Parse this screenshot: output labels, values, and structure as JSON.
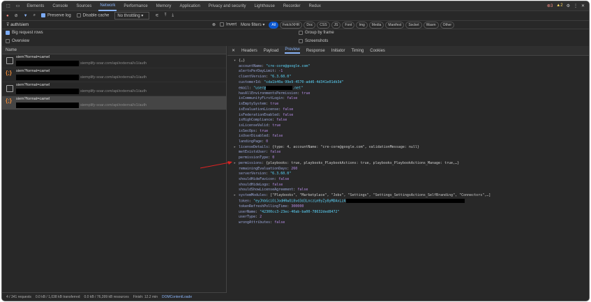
{
  "tabs": [
    "Elements",
    "Console",
    "Sources",
    "Network",
    "Performance",
    "Memory",
    "Application",
    "Privacy and security",
    "Lighthouse",
    "Recorder",
    "Redux"
  ],
  "active_tab": "Network",
  "badges": {
    "errors": "3",
    "warnings": "2"
  },
  "toolbar": {
    "preserve_log": "Preserve log",
    "disable_cache": "Disable cache",
    "throttling": "No throttling"
  },
  "filter": {
    "value": "auth/siem",
    "invert": "Invert",
    "more_filters": "More filters",
    "types": [
      "All",
      "Fetch/XHR",
      "Doc",
      "CSS",
      "JS",
      "Font",
      "Img",
      "Media",
      "Manifest",
      "Socket",
      "Wasm",
      "Other"
    ]
  },
  "options": {
    "big_rows": "Big request rows",
    "overview": "Overview",
    "group_by_frame": "Group by frame",
    "screenshots": "Screenshots"
  },
  "list": {
    "header": "Name",
    "rows": [
      {
        "name": "siem?format=camel",
        "url": "siemplify-soar.com/api/external/v1/auth",
        "icon": "document"
      },
      {
        "name": "siem?format=camel",
        "url": "siemplify-soar.com/api/external/v1/auth",
        "icon": "json"
      },
      {
        "name": "siem?format=camel",
        "url": "siemplify-soar.com/api/external/v1/auth",
        "icon": "document"
      },
      {
        "name": "siem?format=camel",
        "url": "siemplify-soar.com/api/external/v1/auth",
        "icon": "json"
      }
    ]
  },
  "detail_tabs": [
    "Headers",
    "Payload",
    "Preview",
    "Response",
    "Initiator",
    "Timing",
    "Cookies"
  ],
  "active_detail_tab": "Preview",
  "preview": {
    "root": "{…}",
    "lines": [
      {
        "k": "accountName",
        "v": "\"cre-core@google.com\"",
        "t": "s"
      },
      {
        "k": "alertsPerDayLimit",
        "v": "-1",
        "t": "b"
      },
      {
        "k": "clientVersion",
        "v": "\"6.3.60.0\"",
        "t": "s"
      },
      {
        "k": "customerId",
        "v": "\"cda1b40a-99e9-4570-add6-4d341e01db3d\"",
        "t": "s"
      },
      {
        "k": "email",
        "v": "\"user@",
        "v2": ".net\"",
        "t": "s",
        "redact": true
      },
      {
        "k": "hasAllEnvironmentsPermission",
        "v": "true",
        "t": "b"
      },
      {
        "k": "isCommunityFirstLogin",
        "v": "false",
        "t": "b"
      },
      {
        "k": "isEmptySystem",
        "v": "true",
        "t": "b"
      },
      {
        "k": "isEvaluationLicense",
        "v": "false",
        "t": "b"
      },
      {
        "k": "isFederationEnabled",
        "v": "false",
        "t": "b"
      },
      {
        "k": "isHighCompliance",
        "v": "false",
        "t": "b"
      },
      {
        "k": "isLicenseValid",
        "v": "true",
        "t": "b"
      },
      {
        "k": "isSecOps",
        "v": "true",
        "t": "b"
      },
      {
        "k": "isUserDisabled",
        "v": "false",
        "t": "b"
      },
      {
        "k": "landingPage",
        "v": "0",
        "t": "b"
      },
      {
        "k": "licenseDetails",
        "v": "{type: 4, accountName: \"cre-core@google.com\", validationMessage: null}",
        "t": "o",
        "exp": true
      },
      {
        "k": "metExistsUser",
        "v": "false",
        "t": "b"
      },
      {
        "k": "permissionType",
        "v": "0",
        "t": "b"
      },
      {
        "k": "permissions",
        "v": "{playbooks: true, playbooks_PlaybookActions: true, playbooks_PlaybookActions_Manage: true,…}",
        "t": "o",
        "exp": true
      },
      {
        "k": "remainingEvaluationDays",
        "v": "260",
        "t": "b"
      },
      {
        "k": "serverVersion",
        "v": "\"6.3.60.0\"",
        "t": "s"
      },
      {
        "k": "shouldHideFavicon",
        "v": "false",
        "t": "b"
      },
      {
        "k": "shouldHideLogo",
        "v": "false",
        "t": "b"
      },
      {
        "k": "shouldShowLicenseAgreement",
        "v": "false",
        "t": "b"
      },
      {
        "k": "systemModules",
        "v": "[\"Playbooks\", \"Marketplace\", \"Jobs\", \"Settings\", \"Settings_SettingsActions_SelfBranding\", \"Connectors\",…]",
        "t": "o",
        "exp": true
      },
      {
        "k": "token",
        "v": "\"eyJhbGciOiJodHRwOi8vd3d3LnczLm9yZy8yMDAxLzA",
        "t": "s",
        "redact2": true
      },
      {
        "k": "tokenRefreshPollingTime",
        "v": "300000",
        "t": "b"
      },
      {
        "k": "userName",
        "v": "\"42300cc3-23ec-40ab-ba00-78632ded8472\"",
        "t": "s"
      },
      {
        "k": "userType",
        "v": "2",
        "t": "b"
      },
      {
        "k": "wrongAttributes",
        "v": "false",
        "t": "b"
      }
    ]
  },
  "status": {
    "requests": "4 / 341 requests",
    "transferred": "0.0 kB / 1,038 kB transferred",
    "resources": "0.0 kB / 76,399 kB resources",
    "finish": "Finish: 12.2 min",
    "dcl": "DOMContentLoade"
  }
}
